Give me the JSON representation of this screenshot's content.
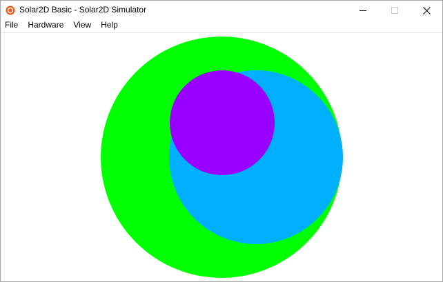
{
  "window": {
    "title": "Solar2D Basic - Solar2D Simulator",
    "app_icon": "solar2d-logo-icon",
    "controls": {
      "minimize_icon": "minimize-icon",
      "maximize_icon": "maximize-icon",
      "close_icon": "close-icon"
    }
  },
  "menubar": {
    "items": [
      {
        "label": "File"
      },
      {
        "label": "Hardware"
      },
      {
        "label": "View"
      },
      {
        "label": "Help"
      }
    ]
  },
  "simulator": {
    "background": "#ffffff",
    "circles": [
      {
        "name": "green-circle",
        "color": "#00ff00"
      },
      {
        "name": "blue-circle",
        "color": "#00b0ff"
      },
      {
        "name": "purple-circle",
        "color": "#9900ff"
      }
    ]
  }
}
